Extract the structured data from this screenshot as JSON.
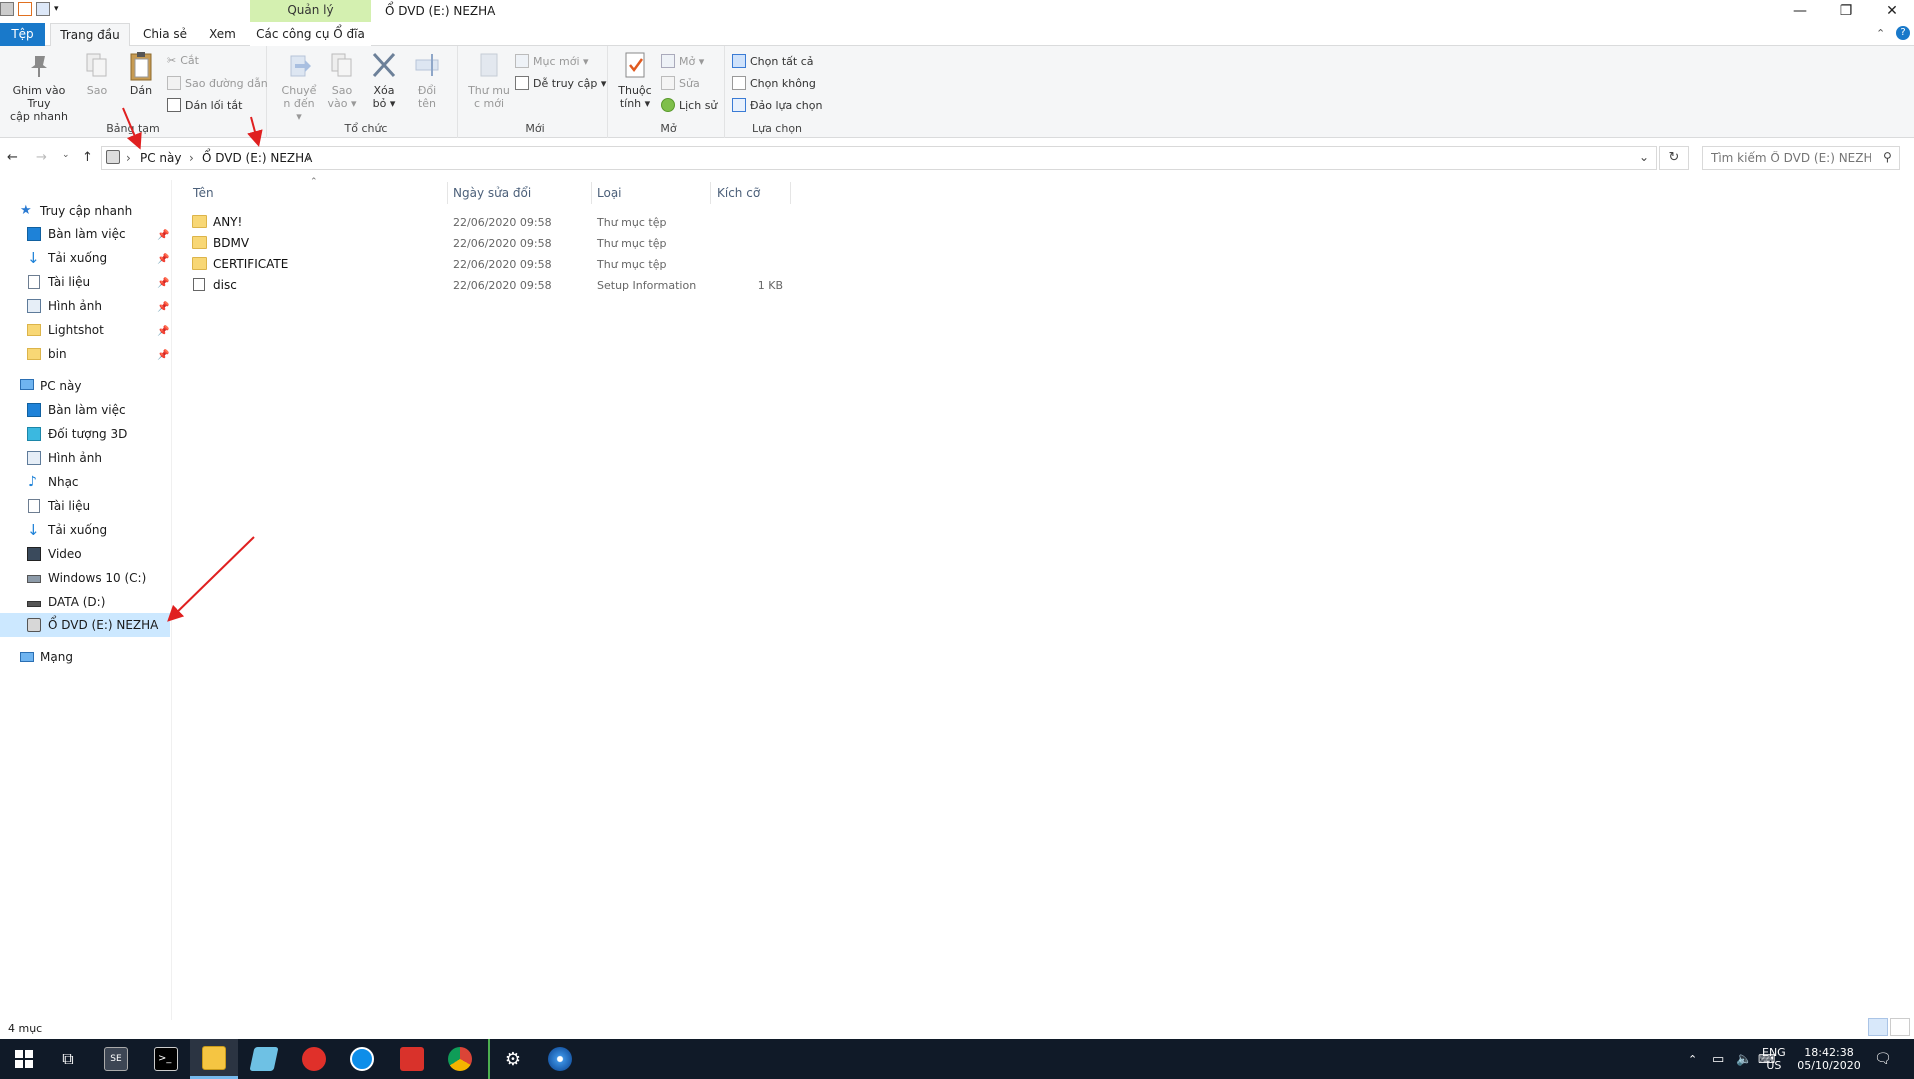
{
  "window": {
    "title": "Ổ DVD (E:) NEZHA",
    "context_header": "Quản lý",
    "minimize": "—",
    "maximize": "❐",
    "close": "✕"
  },
  "tabs": {
    "file": "Tệp",
    "home": "Trang đầu",
    "share": "Chia sẻ",
    "view": "Xem",
    "drive_tools": "Các công cụ Ổ đĩa"
  },
  "ribbon": {
    "clipboard": {
      "label": "Bảng tạm",
      "pin_quick_1": "Ghim vào Truy",
      "pin_quick_2": "cập nhanh",
      "copy": "Sao",
      "paste": "Dán",
      "cut": "Cắt",
      "copy_path": "Sao đường dẫn",
      "paste_shortcut": "Dán lối tắt"
    },
    "organize": {
      "label": "Tổ chức",
      "move_1": "Chuyể",
      "move_2": "n đến ▾",
      "copy_1": "Sao",
      "copy_2": "vào ▾",
      "delete_1": "Xóa",
      "delete_2": "bỏ ▾",
      "rename_1": "Đổi",
      "rename_2": "tên"
    },
    "new": {
      "label": "Mới",
      "new_folder_1": "Thư mu",
      "new_folder_2": "c mới",
      "new_item": "Mục mới ▾",
      "easy_access": "Dễ truy cập ▾"
    },
    "open": {
      "label": "Mở",
      "properties_1": "Thuộc",
      "properties_2": "tính ▾",
      "open": "Mở ▾",
      "edit": "Sửa",
      "history": "Lịch sử"
    },
    "select": {
      "label": "Lựa chọn",
      "select_all": "Chọn tất cả",
      "select_none": "Chọn không",
      "invert": "Đảo lựa chọn"
    }
  },
  "address": {
    "crumbs": [
      "PC này",
      "Ổ DVD (E:) NEZHA"
    ],
    "search_placeholder": "Tìm kiếm Ổ DVD (E:) NEZHA"
  },
  "columns": {
    "name": "Tên",
    "date": "Ngày sửa đổi",
    "type": "Loại",
    "size": "Kích cỡ"
  },
  "files": [
    {
      "name": "ANY!",
      "date": "22/06/2020 09:58",
      "type": "Thư mục tệp",
      "size": "",
      "icon": "folder-icon"
    },
    {
      "name": "BDMV",
      "date": "22/06/2020 09:58",
      "type": "Thư mục tệp",
      "size": "",
      "icon": "folder-icon"
    },
    {
      "name": "CERTIFICATE",
      "date": "22/06/2020 09:58",
      "type": "Thư mục tệp",
      "size": "",
      "icon": "folder-icon"
    },
    {
      "name": "disc",
      "date": "22/06/2020 09:58",
      "type": "Setup Information",
      "size": "1 KB",
      "icon": "settings-file-icon"
    }
  ],
  "navpane": {
    "quick_access": "Truy cập nhanh",
    "quick_items": [
      "Bàn làm việc",
      "Tải xuống",
      "Tài liệu",
      "Hình ảnh",
      "Lightshot",
      "bin"
    ],
    "this_pc": "PC này",
    "pc_items": [
      "Bàn làm việc",
      "Đối tượng 3D",
      "Hình ảnh",
      "Nhạc",
      "Tài liệu",
      "Tải xuống",
      "Video",
      "Windows 10 (C:)",
      "DATA (D:)",
      "Ổ DVD (E:) NEZHA"
    ],
    "network": "Mạng"
  },
  "status": {
    "count": "4 mục"
  },
  "taskbar": {
    "lang1": "ENG",
    "lang2": "US",
    "time": "18:42:38",
    "date": "05/10/2020"
  },
  "colors": {
    "file_tab": "#1979ca",
    "context_header": "#d4f0b0",
    "selection": "#cce8ff",
    "taskbar": "#101a28",
    "annotation_arrow": "#e02020"
  }
}
